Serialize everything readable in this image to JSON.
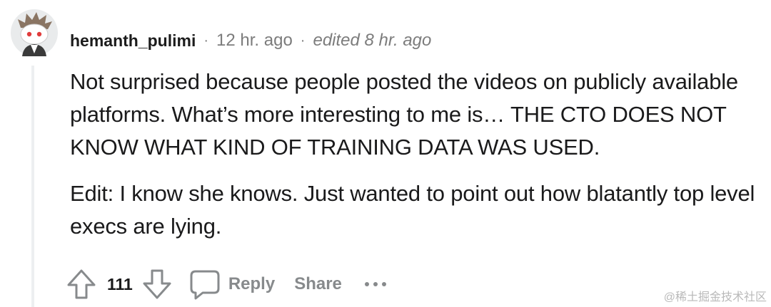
{
  "comment": {
    "author": "hemanth_pulimi",
    "separator": "·",
    "time": "12 hr. ago",
    "edited": "edited 8 hr. ago",
    "paragraphs": [
      "Not surprised because people posted the videos on publicly available platforms. What’s more interesting to me is… THE CTO DOES NOT KNOW WHAT KIND OF TRAINING DATA WAS USED.",
      "Edit: I know she knows. Just wanted to point out how blatantly top level execs are lying."
    ],
    "avatar_icon": "snoo-avatar-icon",
    "colors": {
      "meta_gray": "#7c7c7c",
      "action_gray": "#878a8c",
      "thread_line": "#edeff1"
    }
  },
  "actions": {
    "upvote_icon": "upvote-arrow-icon",
    "vote_count": "111",
    "downvote_icon": "downvote-arrow-icon",
    "reply_icon": "comment-bubble-icon",
    "reply_label": "Reply",
    "share_label": "Share",
    "more_label": "•••"
  },
  "watermark": "@稀土掘金技术社区"
}
